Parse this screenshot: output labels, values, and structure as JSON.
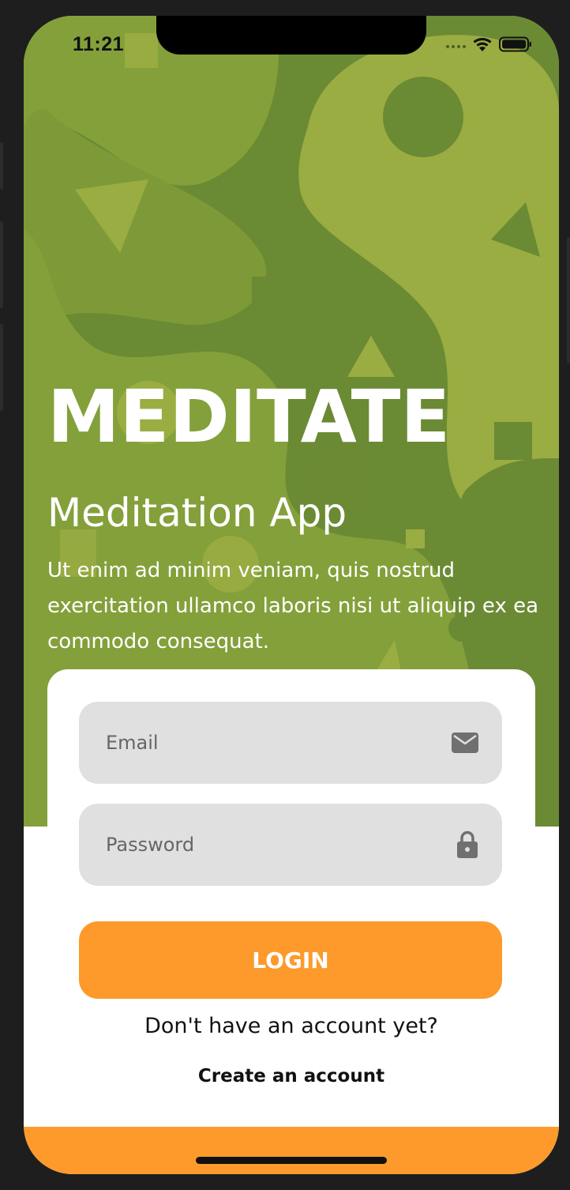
{
  "status_bar": {
    "time": "11:21",
    "signal_icon": "signal-dots-icon",
    "wifi_icon": "wifi-icon",
    "battery_icon": "battery-icon"
  },
  "hero": {
    "title": "MEDITATE",
    "subtitle": "Meditation App",
    "description": "Ut enim ad minim veniam, quis nostrud exercitation ullamco laboris nisi ut aliquip ex ea commodo consequat."
  },
  "login_form": {
    "email": {
      "value": "",
      "placeholder": "Email",
      "icon": "envelope-icon"
    },
    "password": {
      "value": "",
      "placeholder": "Password",
      "icon": "lock-icon"
    },
    "login_label": "LOGIN",
    "no_account_prompt": "Don't have an account yet?",
    "create_account_label": "Create an account"
  },
  "colors": {
    "hero_base": "#6b8a34",
    "hero_light": "#9aad42",
    "hero_mid": "#84a03a",
    "accent": "#fd9a2b",
    "field_bg": "#e0e0e0"
  }
}
